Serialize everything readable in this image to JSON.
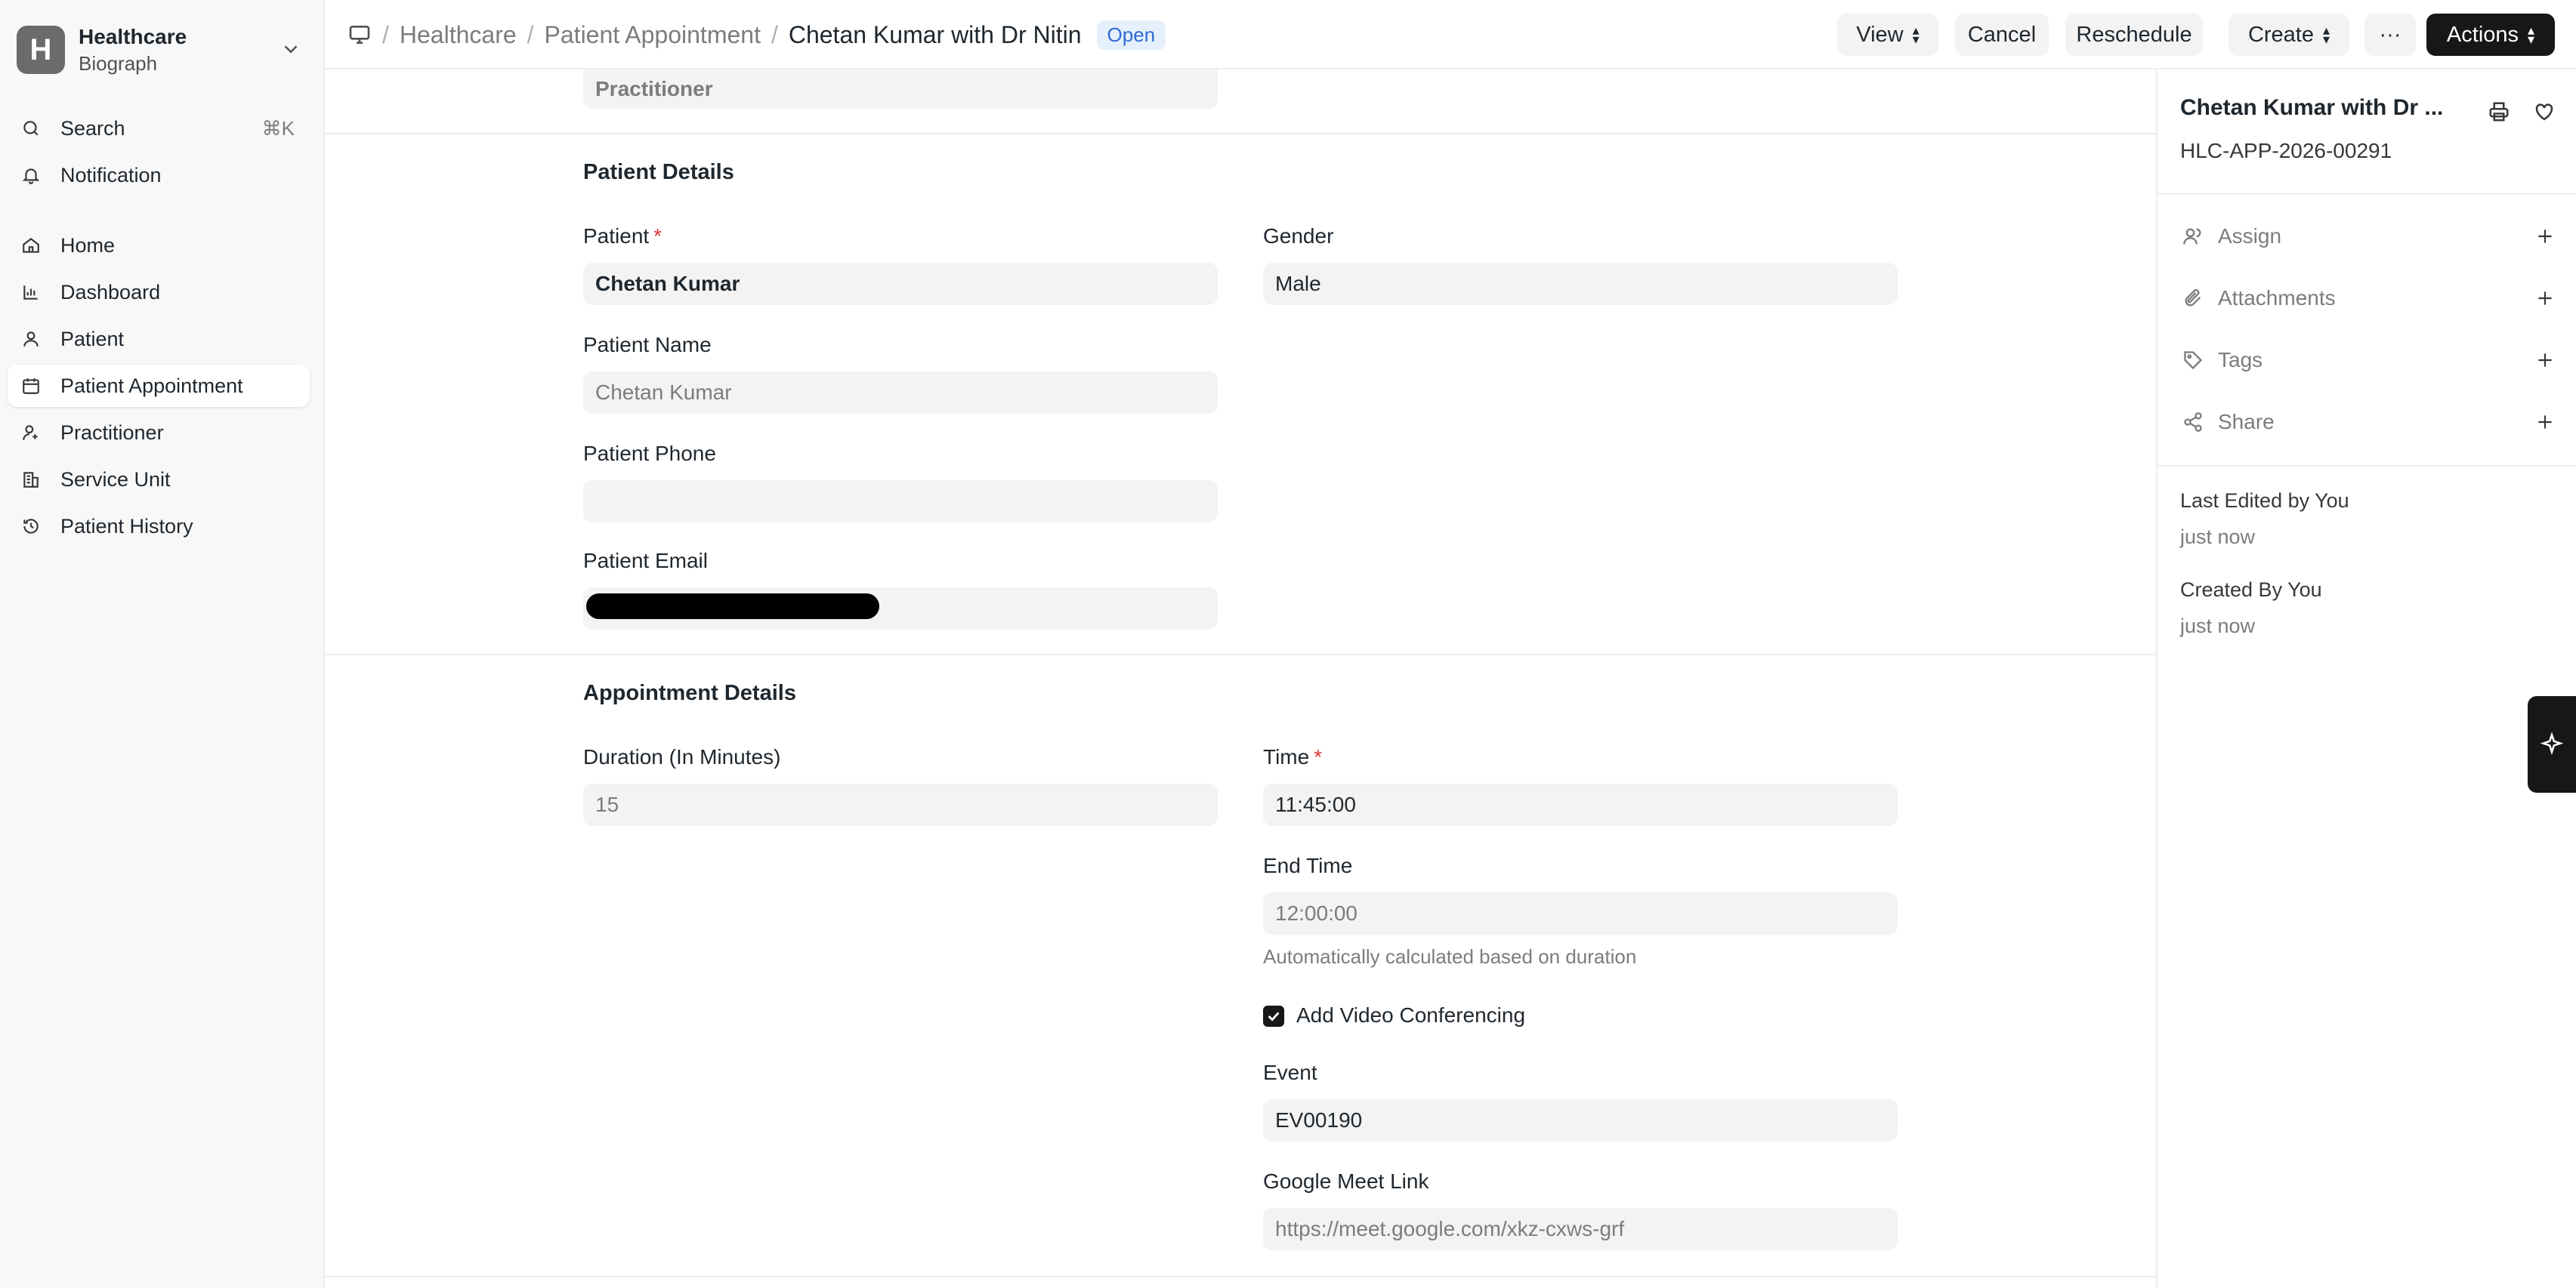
{
  "sidebar": {
    "brand_letter": "H",
    "brand_title": "Healthcare",
    "brand_subtitle": "Biograph",
    "search_label": "Search",
    "search_shortcut": "⌘K",
    "notification_label": "Notification",
    "items": [
      {
        "label": "Home",
        "icon": "home-icon"
      },
      {
        "label": "Dashboard",
        "icon": "chart-icon"
      },
      {
        "label": "Patient",
        "icon": "user-icon"
      },
      {
        "label": "Patient Appointment",
        "icon": "calendar-icon",
        "active": true
      },
      {
        "label": "Practitioner",
        "icon": "user-plus-icon"
      },
      {
        "label": "Service Unit",
        "icon": "building-icon"
      },
      {
        "label": "Patient History",
        "icon": "history-icon"
      }
    ]
  },
  "header": {
    "breadcrumbs": [
      "Healthcare",
      "Patient Appointment",
      "Chetan Kumar with Dr Nitin"
    ],
    "status_badge": "Open",
    "buttons": {
      "view": "View",
      "cancel": "Cancel",
      "reschedule": "Reschedule",
      "create": "Create",
      "more": "···",
      "actions": "Actions"
    }
  },
  "form": {
    "practitioner_value": "Practitioner",
    "patient_details_title": "Patient Details",
    "patient_label": "Patient",
    "patient_value": "Chetan Kumar",
    "gender_label": "Gender",
    "gender_value": "Male",
    "patient_name_label": "Patient Name",
    "patient_name_value": "Chetan Kumar",
    "patient_phone_label": "Patient Phone",
    "patient_phone_value": "",
    "patient_email_label": "Patient Email",
    "patient_email_value": "",
    "appointment_details_title": "Appointment Details",
    "duration_label": "Duration (In Minutes)",
    "duration_value": "15",
    "time_label": "Time",
    "time_value": "11:45:00",
    "end_time_label": "End Time",
    "end_time_value": "12:00:00",
    "end_time_help": "Automatically calculated based on duration",
    "video_conf_label": "Add Video Conferencing",
    "video_conf_checked": true,
    "event_label": "Event",
    "event_value": "EV00190",
    "meet_link_label": "Google Meet Link",
    "meet_link_value": "https://meet.google.com/xkz-cxws-grf"
  },
  "right_panel": {
    "title": "Chetan Kumar with Dr ...",
    "doc_id": "HLC-APP-2026-00291",
    "rows": [
      {
        "label": "Assign",
        "icon": "user-icon"
      },
      {
        "label": "Attachments",
        "icon": "paperclip-icon"
      },
      {
        "label": "Tags",
        "icon": "tag-icon"
      },
      {
        "label": "Share",
        "icon": "share-icon"
      }
    ],
    "last_edited": "Last Edited by You",
    "last_edited_time": "just now",
    "created_by": "Created By You",
    "created_time": "just now"
  },
  "colors": {
    "accent_dark": "#171717",
    "badge_blue": "#2d6bd3",
    "required_red": "#e03636"
  }
}
